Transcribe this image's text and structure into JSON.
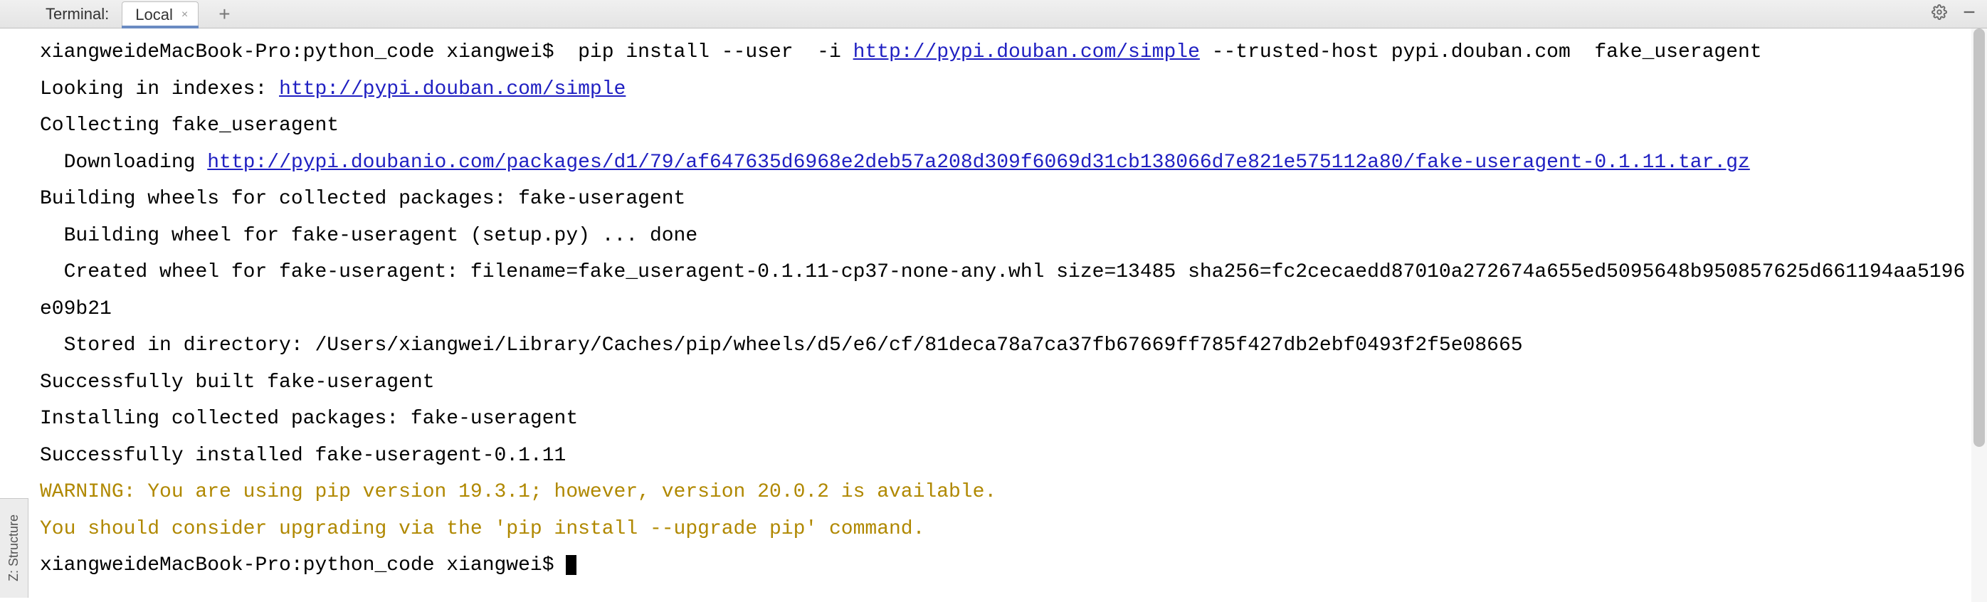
{
  "tabbar": {
    "panel_label": "Terminal:",
    "tab_name": "Local",
    "close_glyph": "×",
    "plus_glyph": "+"
  },
  "sidetab": {
    "label": "Z: Structure"
  },
  "terminal": {
    "prompt1_a": "xiangweideMacBook-Pro:python_code xiangwei$  pip install --user  -i ",
    "link1": "http://pypi.douban.com/simple",
    "prompt1_b": " --trusted-host pypi.douban.com  fake_useragent",
    "line2_a": "Looking in indexes: ",
    "link2": "http://pypi.douban.com/simple",
    "line3": "Collecting fake_useragent",
    "line4_a": "  Downloading ",
    "link3": "http://pypi.doubanio.com/packages/d1/79/af647635d6968e2deb57a208d309f6069d31cb138066d7e821e575112a80/fake-useragent-0.1.11.tar.gz",
    "line5": "Building wheels for collected packages: fake-useragent",
    "line6": "  Building wheel for fake-useragent (setup.py) ... done",
    "line7": "  Created wheel for fake-useragent: filename=fake_useragent-0.1.11-cp37-none-any.whl size=13485 sha256=fc2cecaedd87010a272674a655ed5095648b950857625d661194aa5196e09b21",
    "line8": "  Stored in directory: /Users/xiangwei/Library/Caches/pip/wheels/d5/e6/cf/81deca78a7ca37fb67669ff785f427db2ebf0493f2f5e08665",
    "line9": "Successfully built fake-useragent",
    "line10": "Installing collected packages: fake-useragent",
    "line11": "Successfully installed fake-useragent-0.1.11",
    "warn1": "WARNING: You are using pip version 19.3.1; however, version 20.0.2 is available.",
    "warn2": "You should consider upgrading via the 'pip install --upgrade pip' command.",
    "prompt2": "xiangweideMacBook-Pro:python_code xiangwei$ "
  }
}
